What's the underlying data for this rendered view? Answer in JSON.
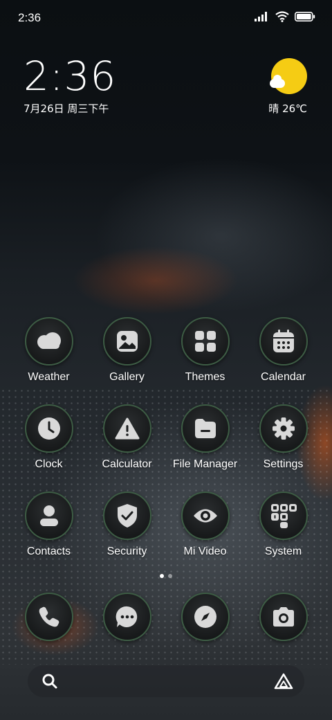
{
  "status_bar": {
    "time": "2:36"
  },
  "clock_widget": {
    "time": "2:36",
    "date": "7月26日 周三下午"
  },
  "weather_widget": {
    "text": "晴 26℃",
    "icon": "partly-sunny-icon",
    "sun_color": "#f5cc14"
  },
  "apps": [
    {
      "label": "Weather",
      "icon": "weather-cloud-icon"
    },
    {
      "label": "Gallery",
      "icon": "gallery-icon"
    },
    {
      "label": "Themes",
      "icon": "themes-grid-icon"
    },
    {
      "label": "Calendar",
      "icon": "calendar-icon"
    },
    {
      "label": "Clock",
      "icon": "clock-icon"
    },
    {
      "label": "Calculator",
      "icon": "calculator-warning-icon"
    },
    {
      "label": "File Manager",
      "icon": "folder-icon"
    },
    {
      "label": "Settings",
      "icon": "gear-icon"
    },
    {
      "label": "Contacts",
      "icon": "contact-person-icon"
    },
    {
      "label": "Security",
      "icon": "shield-check-icon"
    },
    {
      "label": "Mi Video",
      "icon": "eye-icon"
    },
    {
      "label": "System",
      "icon": "system-folder-icon"
    }
  ],
  "dock": [
    {
      "icon": "phone-icon"
    },
    {
      "icon": "messages-icon"
    },
    {
      "icon": "compass-browser-icon"
    },
    {
      "icon": "camera-icon"
    }
  ],
  "theme": {
    "icon_border": "#3d5c44",
    "icon_glyph": "#d9d9d9"
  }
}
